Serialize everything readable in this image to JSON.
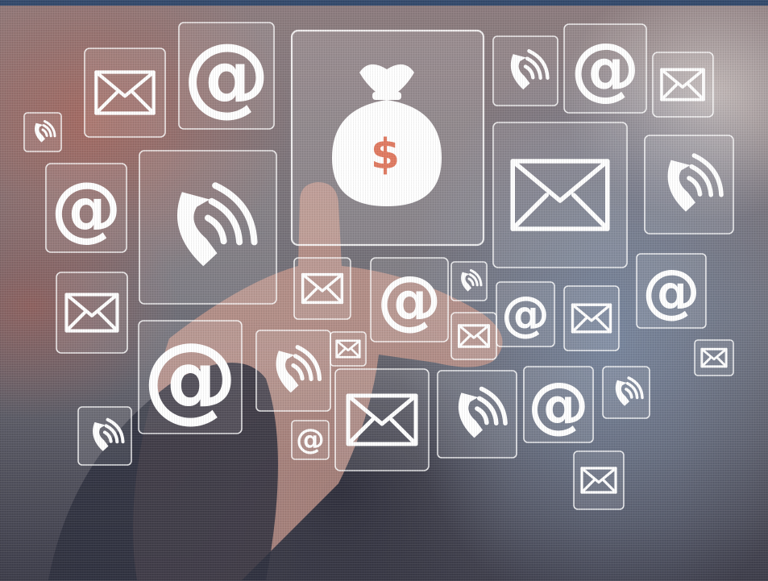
{
  "image": {
    "subject": "businessman-pressing-money-bag-icon",
    "at_symbol": "@",
    "dollar_symbol": "$",
    "colors": {
      "top_bar": "#344a6c",
      "icon_white": "#ffffff",
      "dollar_accent": "#e07b62"
    }
  }
}
